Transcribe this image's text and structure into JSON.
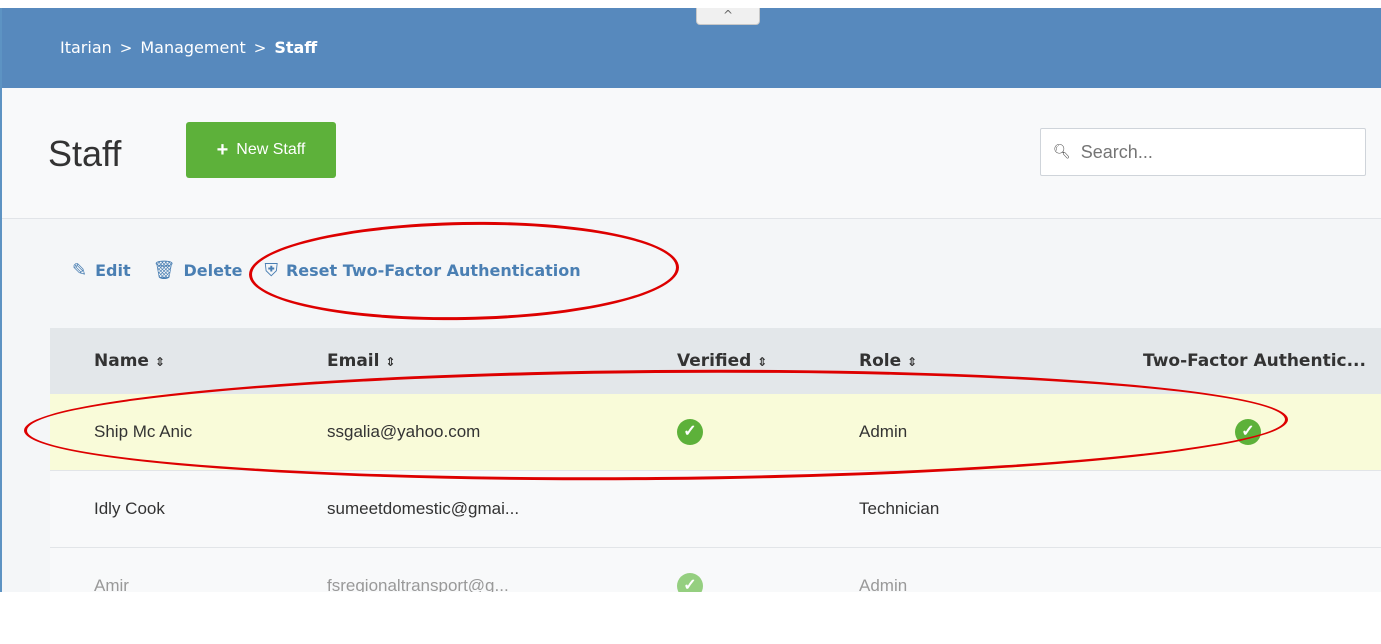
{
  "header": {
    "collapse_glyph": "^",
    "breadcrumb": [
      "Itarian",
      "Management",
      "Staff"
    ],
    "separator": ">"
  },
  "page": {
    "title": "Staff",
    "new_button": "New Staff",
    "search_placeholder": "Search..."
  },
  "toolbar": {
    "edit": "Edit",
    "delete": "Delete",
    "reset_2fa": "Reset Two-Factor Authentication"
  },
  "table": {
    "columns": [
      "Name",
      "Email",
      "Verified",
      "Role",
      "Two-Factor Authentic..."
    ],
    "rows": [
      {
        "name": "Ship Mc Anic",
        "email": "ssgalia@yahoo.com",
        "verified": true,
        "role": "Admin",
        "two_factor": true,
        "selected": true
      },
      {
        "name": "Idly Cook",
        "email": "sumeetdomestic@gmai...",
        "verified": false,
        "role": "Technician",
        "two_factor": false,
        "selected": false
      },
      {
        "name": "Amir",
        "email": "fsregionaltransport@g...",
        "verified": true,
        "role": "Admin",
        "two_factor": false,
        "selected": false
      }
    ]
  },
  "colors": {
    "header_bg": "#5789bd",
    "primary_button": "#5db13a",
    "link": "#4a7fb3",
    "selected_row": "#f9fbd9",
    "annotation": "#dd0000"
  }
}
